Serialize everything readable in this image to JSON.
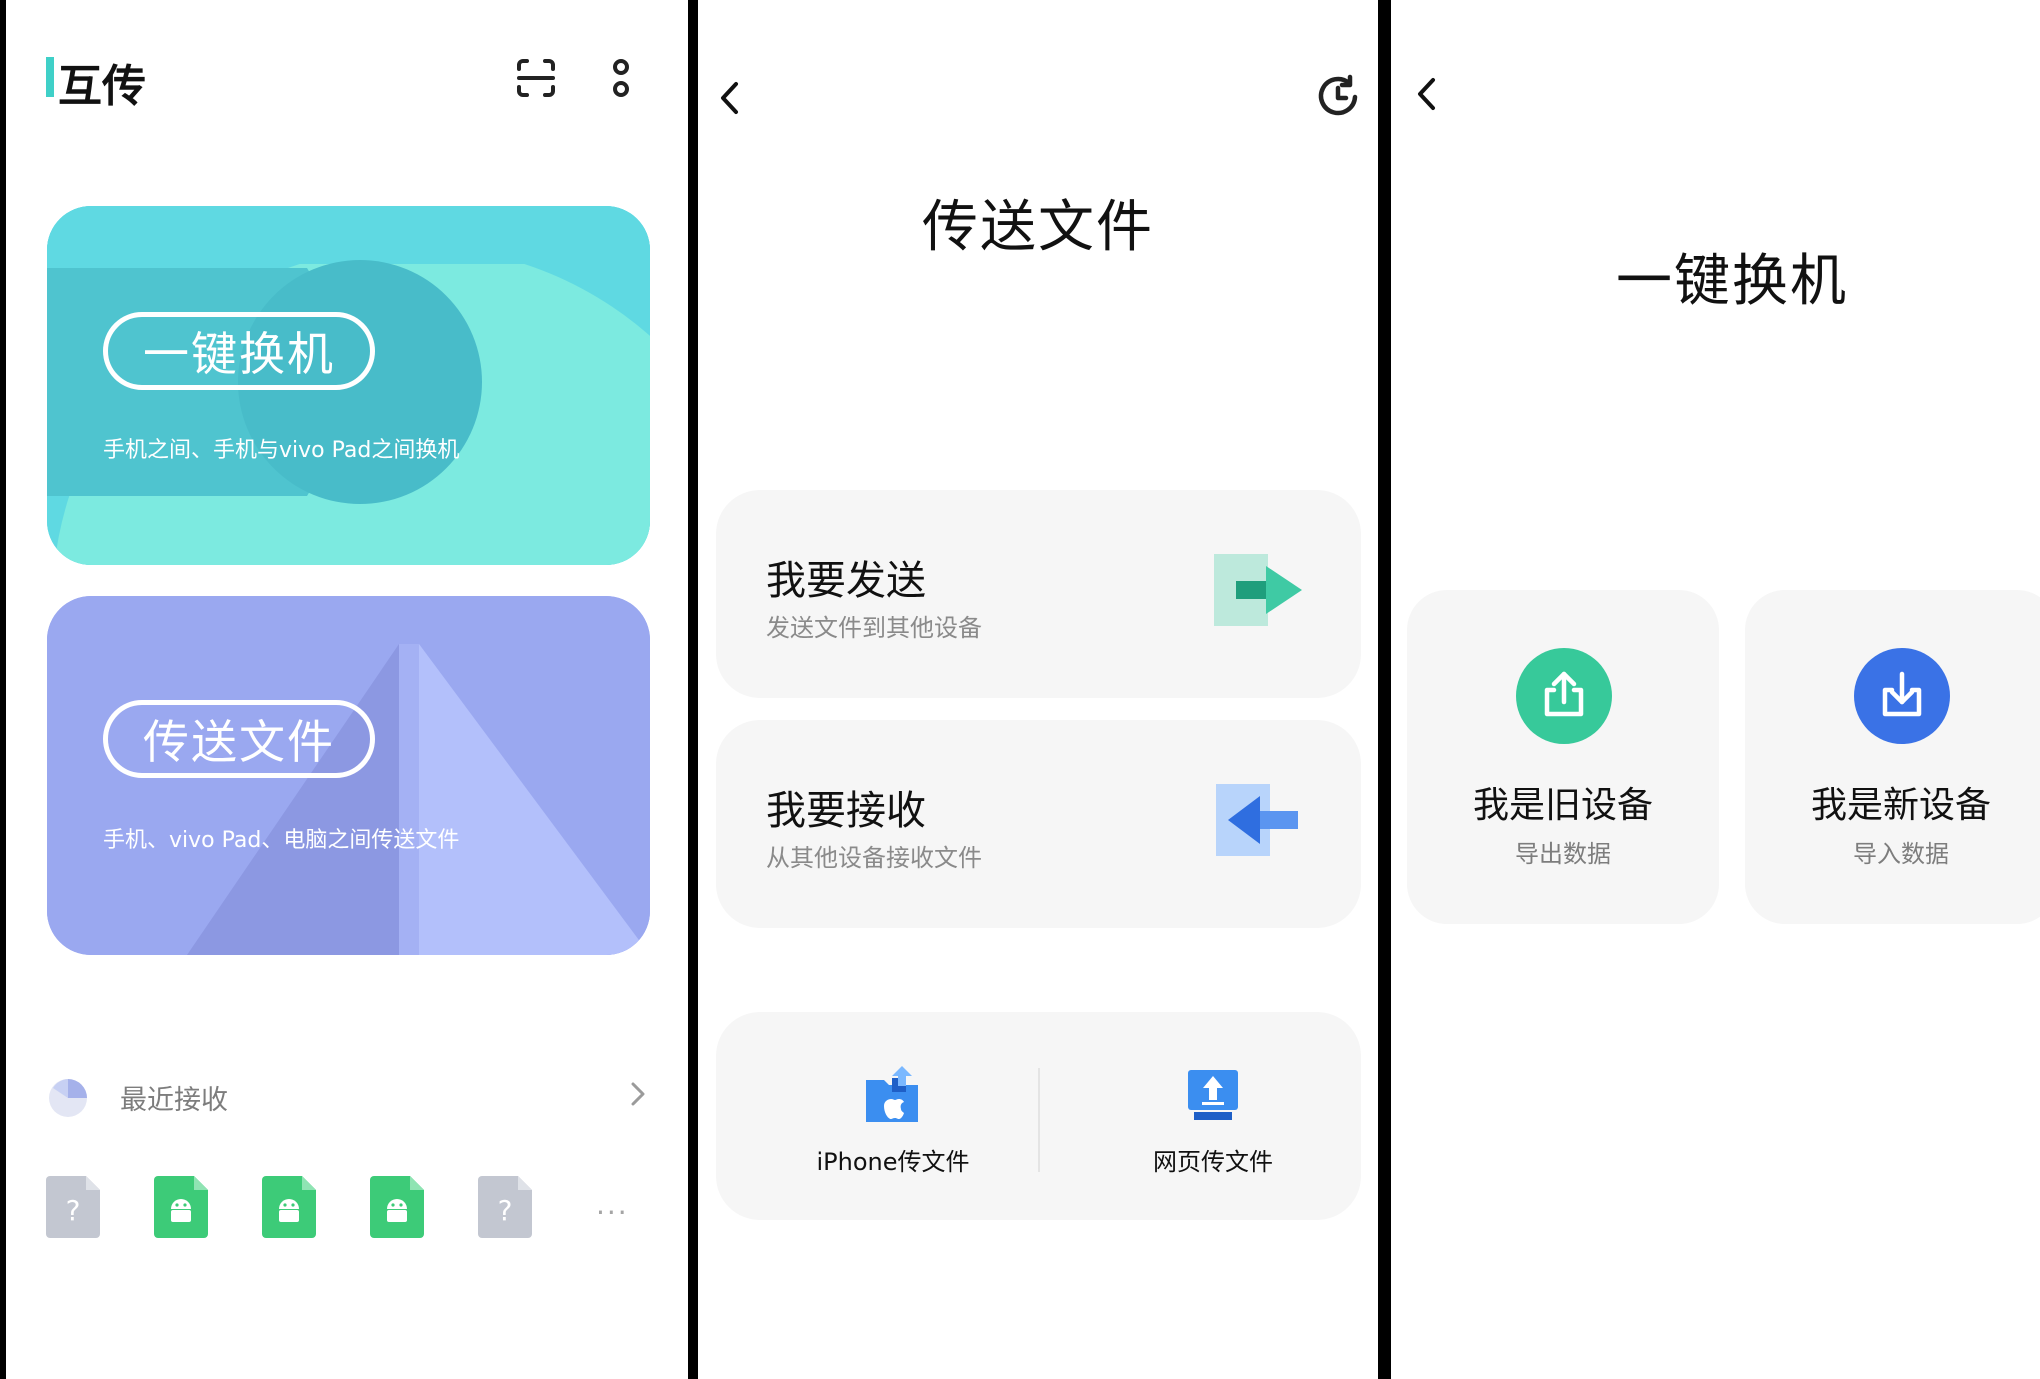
{
  "home": {
    "title": "互传",
    "card_phone_switch": {
      "label": "一键换机",
      "subtitle": "手机之间、手机与vivo Pad之间换机"
    },
    "card_transfer": {
      "label": "传送文件",
      "subtitle": "手机、vivo Pad、电脑之间传送文件"
    },
    "recent": {
      "label": "最近接收"
    },
    "recent_files": [
      {
        "type": "unknown",
        "glyph": "?"
      },
      {
        "type": "android"
      },
      {
        "type": "android"
      },
      {
        "type": "android"
      },
      {
        "type": "unknown",
        "glyph": "?"
      }
    ],
    "more_glyph": "···"
  },
  "transfer": {
    "title": "传送文件",
    "send": {
      "title": "我要发送",
      "subtitle": "发送文件到其他设备"
    },
    "receive": {
      "title": "我要接收",
      "subtitle": "从其他设备接收文件"
    },
    "iphone": {
      "label": "iPhone传文件"
    },
    "web": {
      "label": "网页传文件"
    }
  },
  "phone_switch": {
    "title": "一键换机",
    "old_device": {
      "title": "我是旧设备",
      "subtitle": "导出数据"
    },
    "new_device": {
      "title": "我是新设备",
      "subtitle": "导入数据"
    }
  },
  "colors": {
    "teal_card": "#5fd9e2",
    "purple_card": "#9aa8f0",
    "green_accent": "#37c99a",
    "blue_accent": "#3a72e6",
    "android_green": "#3dcb78",
    "unknown_gray": "#c3c7d1"
  },
  "icons": {
    "scan": "scan-icon",
    "menu": "more-vertical-icon",
    "back": "back-arrow-icon",
    "history": "history-icon",
    "send": "send-arrow-icon",
    "receive": "receive-arrow-icon",
    "iphone": "iphone-folder-icon",
    "web": "web-upload-icon",
    "export": "export-icon",
    "import": "import-icon"
  }
}
